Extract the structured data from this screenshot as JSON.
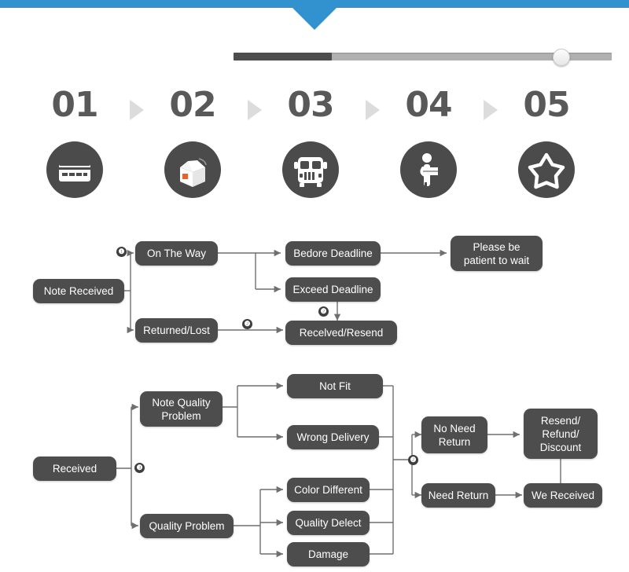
{
  "header": {
    "bar_color": "#3292cf",
    "notch": "down-triangle"
  },
  "slider": {
    "name": "progress-slider",
    "value_percent": 26,
    "track_color": "#b0b0b0",
    "fill_color": "#4d4d4d"
  },
  "steps": [
    {
      "number": "01",
      "icon": "credit-card-icon",
      "icon_name": "payment"
    },
    {
      "number": "02",
      "icon": "open-box-icon",
      "icon_name": "packing"
    },
    {
      "number": "03",
      "icon": "truck-icon",
      "icon_name": "shipping"
    },
    {
      "number": "04",
      "icon": "delivery-person-icon",
      "icon_name": "delivery"
    },
    {
      "number": "05",
      "icon": "star-icon",
      "icon_name": "review"
    }
  ],
  "flow_note_received": {
    "nodes": {
      "note_received": "Note Received",
      "on_the_way": "On The Way",
      "returned_lost": "Returned/Lost",
      "bedore_deadline": "Bedore Deadline",
      "exceed_deadline": "Exceed Deadline",
      "recelved_resend": "Recelved/Resend",
      "please_wait": "Please be\npatient to wait",
      "please_wait_line1": "Please be",
      "please_wait_line2": "patient to wait"
    },
    "badges": {
      "b1": "❶",
      "b2": "❷",
      "b3": "❷"
    }
  },
  "flow_received": {
    "nodes": {
      "received": "Received",
      "note_quality_problem_line1": "Note Quality",
      "note_quality_problem_line2": "Problem",
      "quality_problem": "Quality Problem",
      "not_fit": "Not Fit",
      "wrong_delivery": "Wrong Delivery",
      "color_different": "Color Different",
      "quality_delect": "Quality Delect",
      "damage": "Damage",
      "no_need_return_line1": "No Need",
      "no_need_return_line2": "Return",
      "need_return": "Need Return",
      "resend_line1": "Resend/",
      "resend_line2": "Refund/",
      "resend_line3": "Discount",
      "we_received": "We Received"
    },
    "badges": {
      "b3": "❸",
      "b2": "❷"
    }
  },
  "colors": {
    "node_fill": "#4d4d4d",
    "node_text": "#ffffff",
    "edge": "#6f6f6f",
    "accent_blue": "#3292cf",
    "step_number": "#595959",
    "step_circle": "#4b4b4b"
  }
}
